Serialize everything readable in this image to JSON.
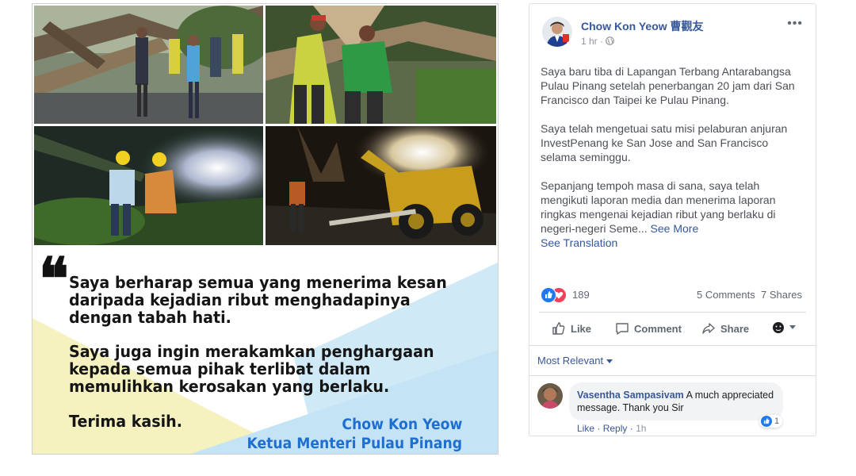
{
  "post": {
    "author": "Chow Kon Yeow 曹觀友",
    "time": "1 hr",
    "privacy_icon": "globe-icon",
    "more_icon": "•••",
    "paragraphs": [
      "Saya baru tiba di Lapangan Terbang Antarabangsa Pulau Pinang setelah penerbangan 20 jam dari San Francisco dan Taipei ke Pulau Pinang.",
      "Saya telah mengetuai satu misi pelaburan anjuran InvestPenang ke San Jose and San Francisco selama seminggu.",
      "Sepanjang tempoh masa di sana, saya telah mengikuti laporan media dan menerima laporan ringkas mengenai kejadian ribut yang berlaku di negeri-negeri Seme..."
    ],
    "see_more": "See More",
    "see_translation": "See Translation",
    "reaction_count": "189",
    "comments_count": "5 Comments",
    "shares_count": "7 Shares",
    "actions": {
      "like": "Like",
      "comment": "Comment",
      "share": "Share"
    },
    "sort_label": "Most Relevant",
    "comment": {
      "author": "Vasentha Sampasivam",
      "text": "A much appreciated message. Thank you Sir",
      "reaction_count": "1",
      "like": "Like",
      "reply": "Reply",
      "separator": "·",
      "time": "1h"
    }
  },
  "image_quote": {
    "mark": "“",
    "paragraph1": "Saya berharap semua yang menerima kesan\ndaripada kejadian ribut menghadapinya\ndengan tabah hati.",
    "paragraph2": "Saya juga ingin merakamkan penghargaan\nkepada semua pihak terlibat dalam\nmemulihkan kerosakan yang berlaku.",
    "thanks": "Terima kasih.",
    "signature_name": "Chow Kon Yeow",
    "signature_title": "Ketua Menteri Pulau Pinang"
  },
  "colors": {
    "link": "#365899",
    "signature": "#1f6fd0",
    "quote_blue": "#cfe9f7",
    "quote_yellow": "#f6f2bf"
  }
}
